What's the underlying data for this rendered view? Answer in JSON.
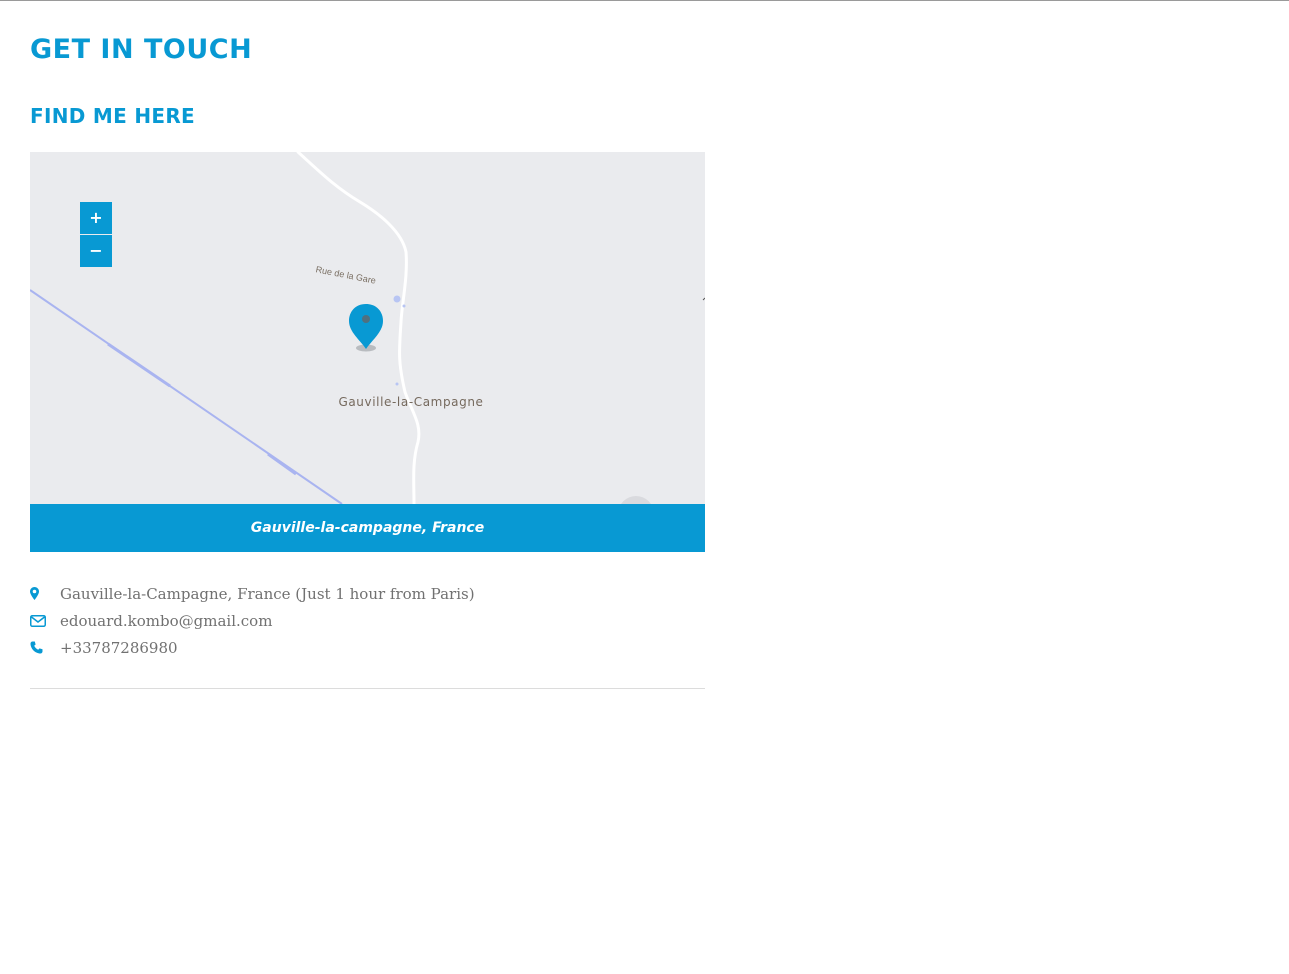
{
  "page": {
    "title": "GET IN TOUCH"
  },
  "location_section": {
    "title": "FIND ME HERE",
    "map": {
      "zoom_in_label": "+",
      "zoom_out_label": "−",
      "street_label": "Rue de la Gare",
      "town_label": "Gauville-la-Campagne",
      "caption": "Gauville-la-campagne, France",
      "marker_icon": "map-marker-icon"
    }
  },
  "contact": {
    "items": [
      {
        "icon": "map-pin-icon",
        "text": "Gauville-la-Campagne, France (Just 1 hour from Paris)"
      },
      {
        "icon": "envelope-icon",
        "text": "edouard.kombo@gmail.com"
      },
      {
        "icon": "phone-icon",
        "text": "+33787286980"
      }
    ]
  },
  "colors": {
    "accent": "#0899d3",
    "map_background": "#eaebee",
    "text": "#717171",
    "road": "#ffffff",
    "railway": "#a9b4f0"
  }
}
